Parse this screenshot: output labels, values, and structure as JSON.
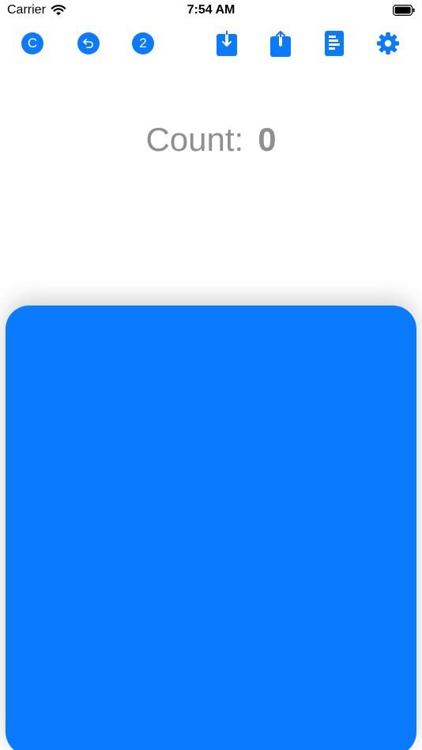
{
  "status_bar": {
    "carrier": "Carrier",
    "time": "7:54 AM",
    "wifi_icon": "wifi-icon",
    "battery_icon": "battery-icon"
  },
  "toolbar": {
    "accent_color": "#0a7aff",
    "clear_label": "C",
    "undo_icon": "undo-arrow-icon",
    "step_label": "2",
    "import_icon": "download-tray-icon",
    "share_icon": "share-icon",
    "report_icon": "document-bars-icon",
    "settings_icon": "gear-icon"
  },
  "counter": {
    "label": "Count:",
    "value": "0",
    "text_color": "#8e8e93"
  },
  "tap_pad": {
    "color": "#0a7aff"
  }
}
